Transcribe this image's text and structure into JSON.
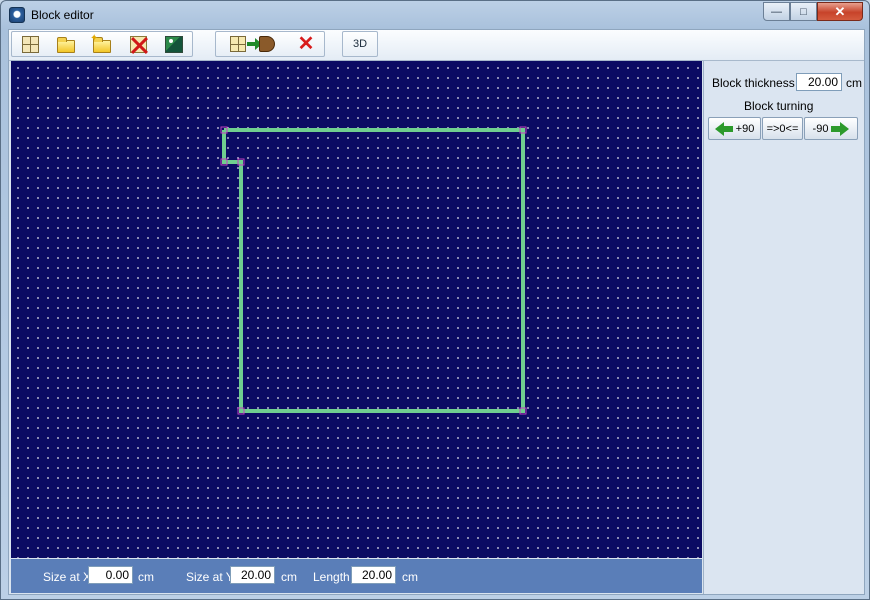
{
  "window": {
    "title": "Block editor"
  },
  "titlebar": {
    "minimize": "—",
    "maximize": "□",
    "close": "✕"
  },
  "toolbar": {
    "three_d_label": "3D",
    "icons": [
      "grid-icon",
      "open-folder-icon",
      "new-folder-icon",
      "delete-block-icon",
      "background-image-icon",
      "generate-block-icon",
      "delete-icon"
    ]
  },
  "panel": {
    "block_thickness_label": "Block thickness",
    "block_thickness_value": "20.00",
    "block_thickness_unit": "cm",
    "block_turning_label": "Block turning",
    "turn_plus90": "+90",
    "turn_reset": "=>0<=",
    "turn_minus90": "-90"
  },
  "bottom": {
    "size_x_label": "Size at X",
    "size_x_value": "0.00",
    "size_x_unit": "cm",
    "size_y_label": "Size at Y",
    "size_y_value": "20.00",
    "size_y_unit": "cm",
    "length_label": "Length",
    "length_value": "20.00",
    "length_unit": "cm"
  },
  "colors": {
    "canvas_bg": "#0b0b63",
    "shape_stroke": "#6fcf8f",
    "vertex_marker": "#c040c0",
    "bottom_bar": "#5a7eb8"
  }
}
